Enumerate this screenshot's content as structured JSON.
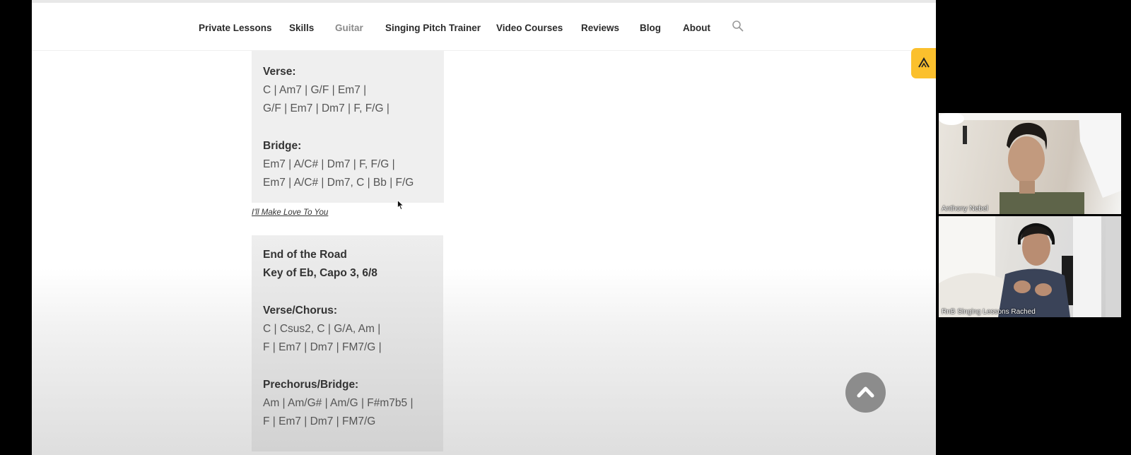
{
  "nav": {
    "items": [
      {
        "label": "Private Lessons",
        "active": false
      },
      {
        "label": "Skills",
        "active": false
      },
      {
        "label": "Guitar",
        "active": true
      },
      {
        "label": "Singing Pitch Trainer",
        "active": false
      },
      {
        "label": "Video Courses",
        "active": false
      },
      {
        "label": "Reviews",
        "active": false
      },
      {
        "label": "Blog",
        "active": false
      },
      {
        "label": "About",
        "active": false
      }
    ],
    "search_icon": "search-icon"
  },
  "song1": {
    "verse_heading": "Verse:",
    "verse_line1": "C | Am7 | G/F | Em7 |",
    "verse_line2": "G/F | Em7 | Dm7 | F, F/G |",
    "bridge_heading": "Bridge:",
    "bridge_line1": "Em7 | A/C# | Dm7 | F, F/G |",
    "bridge_line2": "Em7 | A/C# | Dm7, C | Bb | F/G"
  },
  "song_link": "I'll Make Love To You",
  "song2": {
    "title": "End of the Road",
    "key": "Key of Eb, Capo 3, 6/8",
    "verse_heading": "Verse/Chorus:",
    "verse_line1": "C | Csus2, C | G/A, Am |",
    "verse_line2": "F | Em7 | Dm7 | FM7/G |",
    "prechorus_heading": "Prechorus/Bridge:",
    "prechorus_line1": "Am | Am/G# | Am/G | F#m7b5 |",
    "prechorus_line2": "F | Em7 | Dm7 | FM7/G"
  },
  "widgets": {
    "yellow_tab_icon": "chevron-up-logo-icon",
    "yellow_color": "#fbc02d",
    "scroll_top_icon": "chevron-up-icon"
  },
  "video": {
    "participants": [
      {
        "name": "Anthony Nebel"
      },
      {
        "name": "RnB Singing Lessons Rached"
      }
    ]
  }
}
